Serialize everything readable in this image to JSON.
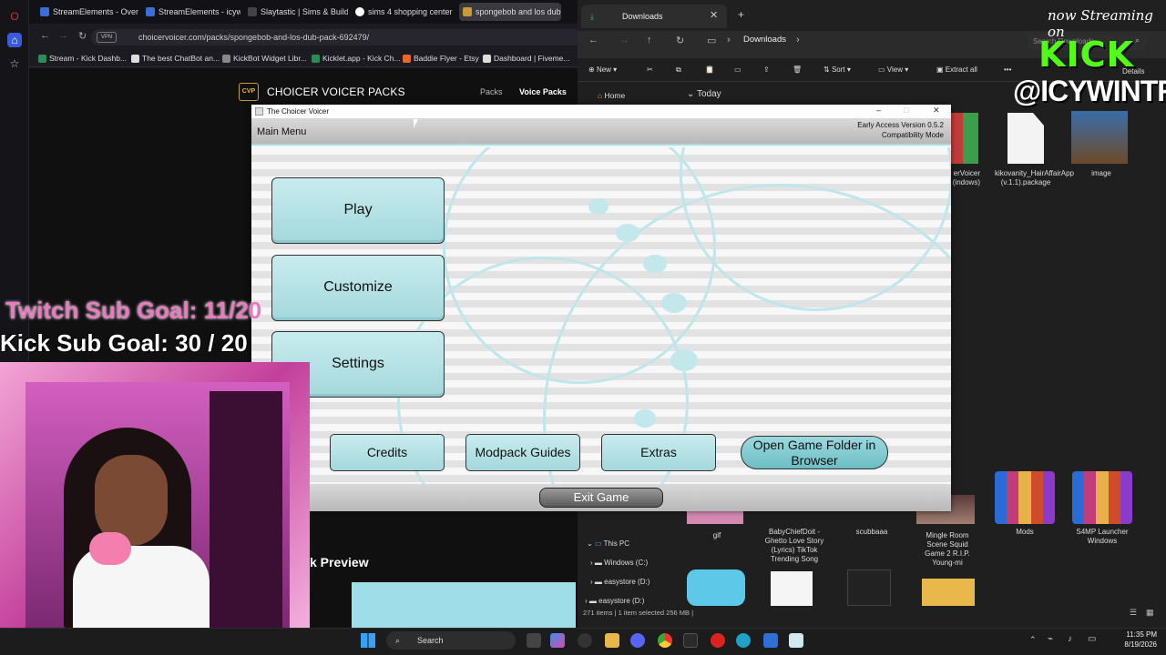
{
  "browser": {
    "tabs": [
      "StreamElements - Overla",
      "StreamElements - icywintr",
      "Slaytastic | Sims & Builds",
      "sims 4 shopping center -",
      "spongebob and los dub p"
    ],
    "url": "choicervoicer.com/packs/spongebob-and-los-dub-pack-692479/",
    "vpn": "VPN",
    "bookmarks": [
      "Stream - Kick Dashb...",
      "The best ChatBot an...",
      "KickBot Widget Libr...",
      "Kicklet.app - Kick Ch...",
      "Baddie Flyer - Etsy",
      "Dashboard | Fiveme..."
    ],
    "site": {
      "logo": "CVP",
      "title": "CHOICER VOICER PACKS",
      "nav": [
        "Packs",
        "Voice Packs"
      ],
      "preview": "k Preview"
    }
  },
  "explorer": {
    "tab": "Downloads",
    "breadcrumb": "Downloads",
    "search_placeholder": "Search Downloads",
    "toolbar": [
      "New",
      "Sort",
      "View",
      "Extract all"
    ],
    "details": "Details",
    "home": "Home",
    "group": "Today",
    "files_top": [
      {
        "name": "erVoicer (indows)"
      },
      {
        "name": "kikovanity_HairAffairApp (v.1.1).package"
      },
      {
        "name": "image"
      }
    ],
    "files_bottom": [
      {
        "name": "gif"
      },
      {
        "name": "BabyChiefDoit - Ghetto Love Story (Lyrics) TikTok Trending Song"
      },
      {
        "name": "scubbaaa"
      },
      {
        "name": "Mingle Room Scene Squid Game 2 R.I.P. Young-mi"
      },
      {
        "name": "Mods"
      },
      {
        "name": "S4MP Launcher Windows"
      }
    ],
    "tree": [
      "This PC",
      "Windows (C:)",
      "easystore (D:)",
      "easystore (D:)"
    ],
    "status": "271 items  |  1 item selected  256 MB  |"
  },
  "game": {
    "title": "The Choicer Voicer",
    "section": "Main Menu",
    "version": [
      "Early Access Version 0.5.2",
      "Compatibility Mode"
    ],
    "main_buttons": [
      "Play",
      "Customize",
      "Settings"
    ],
    "small_buttons": [
      "Credits",
      "Modpack Guides",
      "Extras",
      "Open Game Folder in Browser"
    ],
    "exit": "Exit Game"
  },
  "overlay": {
    "twitch_goal": "Twitch Sub Goal: 11/20",
    "kick_goal": "Kick Sub Goal: 30 / 20",
    "now_streaming": "now Streaming on",
    "platform": "KICK",
    "handle": "@ICYWINTRR"
  },
  "taskbar": {
    "search": "Search",
    "time": "11:35 PM",
    "date": "8/19/2026"
  },
  "colors": {
    "kick_green": "#53fc18",
    "game_button": "#a4d8dc",
    "twitch_pink": "#e87ac0"
  }
}
